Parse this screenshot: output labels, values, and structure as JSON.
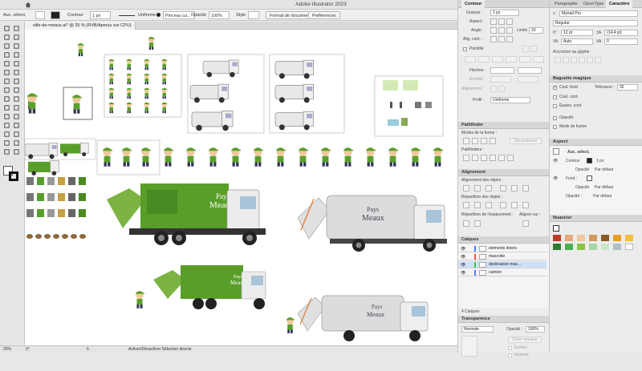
{
  "app": {
    "title": "Adobe Illustrator 2023"
  },
  "control_bar": {
    "selection_label": "Auc. sélect.",
    "stroke_label": "Contour",
    "stroke_weight": "1 px",
    "profile_label": "Uniforme",
    "brush_label": "Pinceau ca...",
    "opacity_label": "Opacité",
    "opacity_value": "100%",
    "style_label": "Style",
    "document_format_button": "Format de document",
    "preferences_button": "Préférences"
  },
  "document_tab": {
    "label": "ville-de-meaux.ai* @ 25 % (RVB/Aperçu sur CPU)"
  },
  "status_bar": {
    "zoom": "25%",
    "rotation": "0°",
    "artboard": "6",
    "status_text": "Activer/Désactiver Sélection directe"
  },
  "stroke_panel": {
    "tabs": [
      "Contour"
    ],
    "weight_label": "Graisse :",
    "weight_value": "1 px",
    "cap_label": "Aspect :",
    "corner_label": "Angle :",
    "limit_label": "Limite :",
    "limit_value": "10",
    "align_label": "Alig. cont. :",
    "dashed_label": "Pointillé",
    "arrows_label": "Flèches :",
    "scale_label": "Échelle :",
    "alignment_label": "Alignement :",
    "profile_label": "Profil :",
    "profile_value": "Uniforme"
  },
  "pathfinder_panel": {
    "title": "Pathfinder",
    "modes_label": "Modes de la forme :",
    "expand_button": "Décomposer",
    "pathfinders_label": "Pathfinders :"
  },
  "align_panel": {
    "title": "Alignement",
    "align_objects_label": "Alignement des objets :",
    "distribute_objects_label": "Répartition des objets :",
    "distribute_spacing_label": "Répartition de l'espacement :",
    "align_to_label": "Aligner sur :"
  },
  "layers_panel": {
    "title": "Calques",
    "layers": [
      {
        "name": "elements divers",
        "color": "#4a7cff"
      },
      {
        "name": "mascotte",
        "color": "#ff4a4a"
      },
      {
        "name": "declinaison mas...",
        "color": "#3cc83c"
      },
      {
        "name": "camion",
        "color": "#4a7cff"
      }
    ],
    "count_label": "4 Calques"
  },
  "transparency_panel": {
    "title": "Transparence",
    "mode_value": "Normale",
    "opacity_label": "Opacité :",
    "opacity_value": "100%",
    "make_mask_button": "Créer masque",
    "clip_label": "Écrêter",
    "invert_label": "Inverser"
  },
  "character_panel": {
    "tabs": [
      "Paragraphe",
      "OpenType",
      "Caractère"
    ],
    "font_family": "Myriad Pro",
    "font_style": "Regular",
    "font_size": "12 pt",
    "leading": "(14,4 pt)",
    "kerning": "Auto",
    "tracking": "0",
    "snap_label": "Accrocher au glyphe"
  },
  "magic_wand_panel": {
    "title": "Baguette magique",
    "fill_color_label": "Coul. fond",
    "tolerance_label": "Tolérance :",
    "tolerance_value": "32",
    "stroke_color_label": "Coul. cont.",
    "stroke_weight_label": "Épaiss. cont.",
    "opacity_label": "Opacité",
    "blend_mode_label": "Mode de fusion"
  },
  "appearance_panel": {
    "title": "Aspect",
    "selection_label": "Auc. sélect.",
    "stroke_label": "Contour",
    "stroke_value": "1 px",
    "stroke_opacity_label": "Opacité",
    "stroke_opacity_value": "Par défaut",
    "fill_label": "Fond :",
    "fill_opacity_label": "Opacité",
    "fill_opacity_value": "Par défaut",
    "opacity_label": "Opacité :",
    "opacity_value": "Par défaut"
  },
  "swatches_panel": {
    "title": "Nuancier",
    "colors": [
      "#c0392b",
      "#e8a87c",
      "#f0c8a0",
      "#d09a5c",
      "#8b5a2b",
      "#e8a020",
      "#f4c040",
      "#2e7d32",
      "#4caf50",
      "#8bc34a",
      "#a5d6a7",
      "#c8e6c9",
      "#b0bec5",
      "#ffffff"
    ]
  },
  "artwork": {
    "truck_logo_line1": "Pays",
    "truck_logo_line2": "Meaux"
  }
}
